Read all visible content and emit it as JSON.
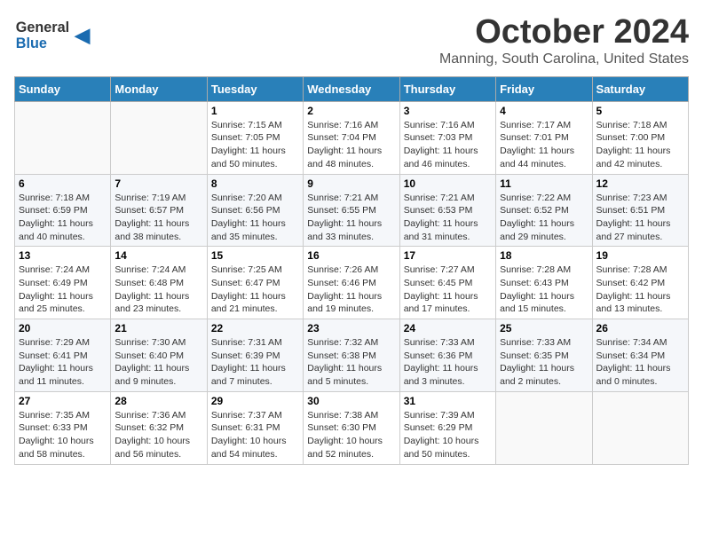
{
  "logo": {
    "line1": "General",
    "line2": "Blue"
  },
  "header": {
    "month": "October 2024",
    "location": "Manning, South Carolina, United States"
  },
  "weekdays": [
    "Sunday",
    "Monday",
    "Tuesday",
    "Wednesday",
    "Thursday",
    "Friday",
    "Saturday"
  ],
  "weeks": [
    [
      {
        "day": "",
        "info": ""
      },
      {
        "day": "",
        "info": ""
      },
      {
        "day": "1",
        "info": "Sunrise: 7:15 AM\nSunset: 7:05 PM\nDaylight: 11 hours and 50 minutes."
      },
      {
        "day": "2",
        "info": "Sunrise: 7:16 AM\nSunset: 7:04 PM\nDaylight: 11 hours and 48 minutes."
      },
      {
        "day": "3",
        "info": "Sunrise: 7:16 AM\nSunset: 7:03 PM\nDaylight: 11 hours and 46 minutes."
      },
      {
        "day": "4",
        "info": "Sunrise: 7:17 AM\nSunset: 7:01 PM\nDaylight: 11 hours and 44 minutes."
      },
      {
        "day": "5",
        "info": "Sunrise: 7:18 AM\nSunset: 7:00 PM\nDaylight: 11 hours and 42 minutes."
      }
    ],
    [
      {
        "day": "6",
        "info": "Sunrise: 7:18 AM\nSunset: 6:59 PM\nDaylight: 11 hours and 40 minutes."
      },
      {
        "day": "7",
        "info": "Sunrise: 7:19 AM\nSunset: 6:57 PM\nDaylight: 11 hours and 38 minutes."
      },
      {
        "day": "8",
        "info": "Sunrise: 7:20 AM\nSunset: 6:56 PM\nDaylight: 11 hours and 35 minutes."
      },
      {
        "day": "9",
        "info": "Sunrise: 7:21 AM\nSunset: 6:55 PM\nDaylight: 11 hours and 33 minutes."
      },
      {
        "day": "10",
        "info": "Sunrise: 7:21 AM\nSunset: 6:53 PM\nDaylight: 11 hours and 31 minutes."
      },
      {
        "day": "11",
        "info": "Sunrise: 7:22 AM\nSunset: 6:52 PM\nDaylight: 11 hours and 29 minutes."
      },
      {
        "day": "12",
        "info": "Sunrise: 7:23 AM\nSunset: 6:51 PM\nDaylight: 11 hours and 27 minutes."
      }
    ],
    [
      {
        "day": "13",
        "info": "Sunrise: 7:24 AM\nSunset: 6:49 PM\nDaylight: 11 hours and 25 minutes."
      },
      {
        "day": "14",
        "info": "Sunrise: 7:24 AM\nSunset: 6:48 PM\nDaylight: 11 hours and 23 minutes."
      },
      {
        "day": "15",
        "info": "Sunrise: 7:25 AM\nSunset: 6:47 PM\nDaylight: 11 hours and 21 minutes."
      },
      {
        "day": "16",
        "info": "Sunrise: 7:26 AM\nSunset: 6:46 PM\nDaylight: 11 hours and 19 minutes."
      },
      {
        "day": "17",
        "info": "Sunrise: 7:27 AM\nSunset: 6:45 PM\nDaylight: 11 hours and 17 minutes."
      },
      {
        "day": "18",
        "info": "Sunrise: 7:28 AM\nSunset: 6:43 PM\nDaylight: 11 hours and 15 minutes."
      },
      {
        "day": "19",
        "info": "Sunrise: 7:28 AM\nSunset: 6:42 PM\nDaylight: 11 hours and 13 minutes."
      }
    ],
    [
      {
        "day": "20",
        "info": "Sunrise: 7:29 AM\nSunset: 6:41 PM\nDaylight: 11 hours and 11 minutes."
      },
      {
        "day": "21",
        "info": "Sunrise: 7:30 AM\nSunset: 6:40 PM\nDaylight: 11 hours and 9 minutes."
      },
      {
        "day": "22",
        "info": "Sunrise: 7:31 AM\nSunset: 6:39 PM\nDaylight: 11 hours and 7 minutes."
      },
      {
        "day": "23",
        "info": "Sunrise: 7:32 AM\nSunset: 6:38 PM\nDaylight: 11 hours and 5 minutes."
      },
      {
        "day": "24",
        "info": "Sunrise: 7:33 AM\nSunset: 6:36 PM\nDaylight: 11 hours and 3 minutes."
      },
      {
        "day": "25",
        "info": "Sunrise: 7:33 AM\nSunset: 6:35 PM\nDaylight: 11 hours and 2 minutes."
      },
      {
        "day": "26",
        "info": "Sunrise: 7:34 AM\nSunset: 6:34 PM\nDaylight: 11 hours and 0 minutes."
      }
    ],
    [
      {
        "day": "27",
        "info": "Sunrise: 7:35 AM\nSunset: 6:33 PM\nDaylight: 10 hours and 58 minutes."
      },
      {
        "day": "28",
        "info": "Sunrise: 7:36 AM\nSunset: 6:32 PM\nDaylight: 10 hours and 56 minutes."
      },
      {
        "day": "29",
        "info": "Sunrise: 7:37 AM\nSunset: 6:31 PM\nDaylight: 10 hours and 54 minutes."
      },
      {
        "day": "30",
        "info": "Sunrise: 7:38 AM\nSunset: 6:30 PM\nDaylight: 10 hours and 52 minutes."
      },
      {
        "day": "31",
        "info": "Sunrise: 7:39 AM\nSunset: 6:29 PM\nDaylight: 10 hours and 50 minutes."
      },
      {
        "day": "",
        "info": ""
      },
      {
        "day": "",
        "info": ""
      }
    ]
  ]
}
